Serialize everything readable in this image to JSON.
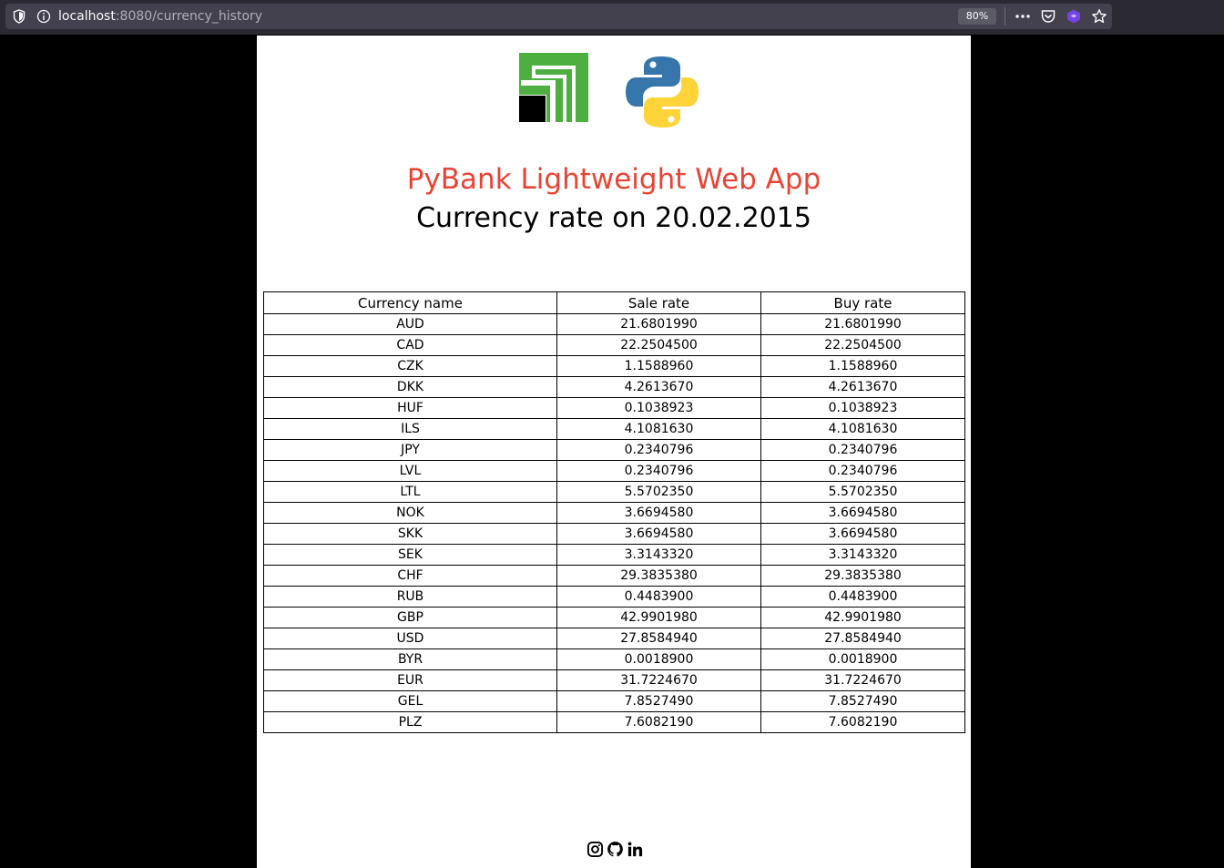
{
  "browser": {
    "url_host": "localhost",
    "url_path": ":8080/currency_history",
    "zoom": "80%",
    "icons": [
      "shield-icon",
      "info-icon",
      "more-icon",
      "pocket-icon",
      "extension-icon",
      "star-icon"
    ]
  },
  "header": {
    "title": "PyBank Lightweight Web App",
    "subtitle": "Currency rate on 20.02.2015",
    "title_color": "#ea4335"
  },
  "table": {
    "headers": [
      "Currency name",
      "Sale rate",
      "Buy rate"
    ],
    "rows": [
      [
        "AUD",
        "21.6801990",
        "21.6801990"
      ],
      [
        "CAD",
        "22.2504500",
        "22.2504500"
      ],
      [
        "CZK",
        "1.1588960",
        "1.1588960"
      ],
      [
        "DKK",
        "4.2613670",
        "4.2613670"
      ],
      [
        "HUF",
        "0.1038923",
        "0.1038923"
      ],
      [
        "ILS",
        "4.1081630",
        "4.1081630"
      ],
      [
        "JPY",
        "0.2340796",
        "0.2340796"
      ],
      [
        "LVL",
        "0.2340796",
        "0.2340796"
      ],
      [
        "LTL",
        "5.5702350",
        "5.5702350"
      ],
      [
        "NOK",
        "3.6694580",
        "3.6694580"
      ],
      [
        "SKK",
        "3.6694580",
        "3.6694580"
      ],
      [
        "SEK",
        "3.3143320",
        "3.3143320"
      ],
      [
        "CHF",
        "29.3835380",
        "29.3835380"
      ],
      [
        "RUB",
        "0.4483900",
        "0.4483900"
      ],
      [
        "GBP",
        "42.9901980",
        "42.9901980"
      ],
      [
        "USD",
        "27.8584940",
        "27.8584940"
      ],
      [
        "BYR",
        "0.0018900",
        "0.0018900"
      ],
      [
        "EUR",
        "31.7224670",
        "31.7224670"
      ],
      [
        "GEL",
        "7.8527490",
        "7.8527490"
      ],
      [
        "PLZ",
        "7.6082190",
        "7.6082190"
      ]
    ]
  },
  "footer": {
    "icons": [
      "instagram-icon",
      "github-icon",
      "linkedin-icon"
    ]
  }
}
